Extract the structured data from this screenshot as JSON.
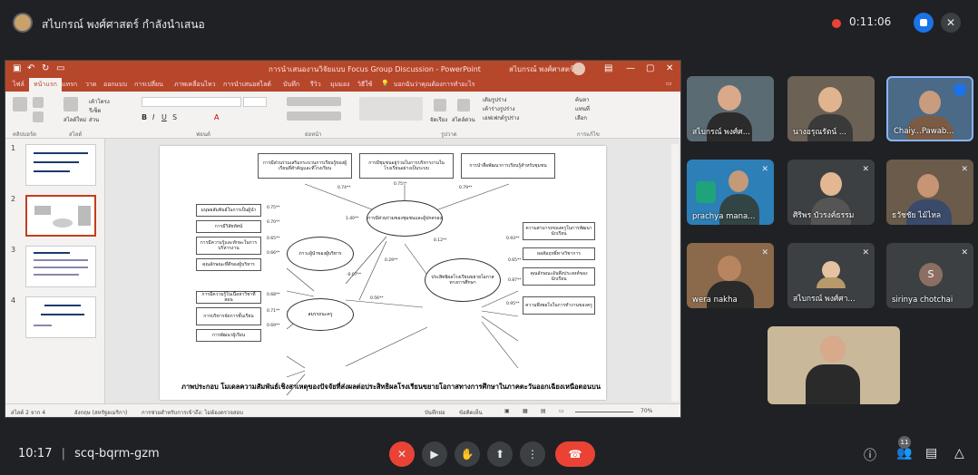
{
  "meet": {
    "presenter_label": "สไบกรณ์ พงศ์ศาสตร์ กำลังนำเสนอ",
    "timer": "0:11:06",
    "time": "10:17",
    "separator": "|",
    "meeting_code": "scq-bqrm-gzm",
    "people_count": "11"
  },
  "ppt": {
    "window_title": "การนำเสนองานวิจัยแบบ Focus Group Discussion - PowerPoint",
    "user_name": "สไบกรณ์ พงศ์ศาสตร์",
    "tabs": [
      "ไฟล์",
      "หน้าแรก",
      "แทรก",
      "วาด",
      "ออกแบบ",
      "การเปลี่ยน",
      "ภาพเคลื่อนไหว",
      "การนำเสนอสไลด์",
      "บันทึก",
      "รีวิว",
      "มุมมอง",
      "วิธีใช้"
    ],
    "tell_me": "บอกฉันว่าคุณต้องการทำอะไร",
    "ribbon_groups": [
      "คลิปบอร์ด",
      "สไลด์",
      "ฟอนต์",
      "ย่อหน้า",
      "รูปวาด",
      "การแก้ไข"
    ],
    "ribbon_items": {
      "new_slide": "สไลด์ใหม่",
      "layout": "เค้าโครง",
      "reset": "รีเซ็ต",
      "section": "ส่วน",
      "find": "ค้นหา",
      "replace": "แทนที่",
      "select": "เลือก",
      "arrange": "จัดเรียง",
      "quick_styles": "สไตล์ด่วน",
      "shape_fill": "เติมรูปร่าง",
      "shape_outline": "เค้าร่างรูปร่าง",
      "shape_effects": "เอฟเฟกต์รูปร่าง"
    },
    "slide_numbers": [
      "1",
      "2",
      "3",
      "4"
    ],
    "status": {
      "slide_of": "สไลด์ 2 จาก 4",
      "language": "อังกฤษ (สหรัฐอเมริกา)",
      "accessibility": "การช่วยสำหรับการเข้าถึง: ไม่ต้องตรวจสอบ",
      "notes": "บันทึกย่อ",
      "comments": "ข้อคิดเห็น",
      "zoom": "70%"
    }
  },
  "diagram": {
    "caption": "ภาพประกอบ  โมเดลความสัมพันธ์เชิงสาเหตุของปัจจัยที่ส่งผลต่อประสิทธิผลโรงเรียนขยายโอกาสทางการศึกษาในภาคตะวันออกเฉียงเหนือตอนบน",
    "top_boxes": [
      "การมีส่วนร่วมเสริมกระบวนการเรียนรู้ของผู้เรียนที่สำคัญและที่โรงเรียน",
      "การมีชุมชนอยู่ร่วมในการบริหารงานในโรงเรียนอย่างเป็นระบบ",
      "การนำสื่อพัฒนาการเรียนรู้สำหรับชุมชน"
    ],
    "left_boxes_a": [
      "มนุษยสัมพันธ์ในการเป็นผู้นำ",
      "การมีวิสัยทัศน์",
      "การมีความรู้และทักษะในการบริหารงาน",
      "คุณลักษณะที่ดีของผู้บริหาร"
    ],
    "left_boxes_b": [
      "การมีความรู้ในเนื้อหาวิชาที่สอน",
      "การบริหารจัดการชั้นเรียน",
      "การพัฒนาผู้เรียน"
    ],
    "right_boxes": [
      "ความสามารถของครูในการพัฒนานักเรียน",
      "ผลสัมฤทธิ์ทางวิชาการ",
      "คุณลักษณะอันพึงประสงค์ของนักเรียน",
      "ความพึงพอใจในการทำงานของครู"
    ],
    "ellipses": {
      "community": "การมีส่วนร่วมของชุมชนและผู้ปกครอง",
      "leader": "ภาวะผู้นำของผู้บริหาร",
      "teacher": "สมรรถนะครู",
      "effectiveness": "ประสิทธิผลโรงเรียนขยายโอกาสทางการศึกษา"
    },
    "coefficients": [
      "0.74**",
      "0.75**",
      "0.79**",
      "0.75**",
      "0.70**",
      "0.65**",
      "0.66**",
      "1.40**",
      "0.12**",
      "0.29**",
      "-0.07**",
      "0.56**",
      "0.68**",
      "0.71**",
      "0.69**",
      "0.93**",
      "0.65**",
      "0.87**",
      "0.95**"
    ]
  },
  "participants": [
    {
      "name": "สไบกรณ์ พงศ์ศ..."
    },
    {
      "name": "นางอรุณรัตน์ ..."
    },
    {
      "name": "Chaiy...Pawab..."
    },
    {
      "name": "prachya mana..."
    },
    {
      "name": "ศิริพร บัวรงค์ธรรม"
    },
    {
      "name": "ธวัชชัย ไม้ไหล"
    },
    {
      "name": "wera nakha"
    },
    {
      "name": "สไบกรณ์ พงศ์ศา..."
    },
    {
      "name": "sirinya chotchai",
      "initial": "S"
    }
  ],
  "colors": {
    "meet_bg": "#202124",
    "ppt_red": "#b7472a",
    "end_call": "#ea4335",
    "accent_blue": "#1a73e8"
  }
}
